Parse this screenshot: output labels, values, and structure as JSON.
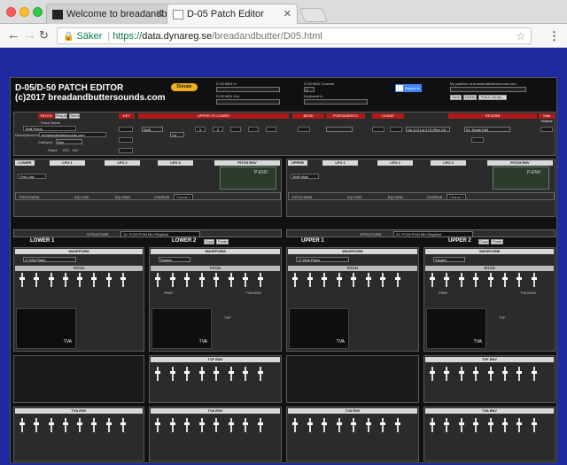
{
  "browser": {
    "tabs": [
      {
        "label": "Welcome to breadandbuttersound",
        "active": false
      },
      {
        "label": "D-05 Patch Editor",
        "active": true
      }
    ],
    "address": {
      "secure_label": "Säker",
      "protocol": "https://",
      "host": "data.dynareg.se",
      "path": "/breadandbutter/D05.html"
    }
  },
  "editor": {
    "title_line1": "D-05/D-50 PATCH EDITOR",
    "title_line2": "(c)2017 breadandbuttersounds.com",
    "donate": "Donate",
    "midi_in": "D-05 MIDI In",
    "midi_out": "D-05 MIDI Out",
    "midi_channel": "D-05 MIDI Channel",
    "midi_channel_value": "1",
    "keyboard_in": "Keyboard In",
    "google_signin": "Signed in",
    "patches_at": "My patches at breadandbuttersounds.com",
    "save_btn": "Save",
    "delete_btn": "Delete",
    "library_btn": "Patch Library...",
    "patch_label": "PATCH",
    "request_btn": "Request",
    "send_btn": "Send",
    "patch_name_label": "Patch Name",
    "patch_name": "BnB Piano",
    "desc_label": "Description/Info",
    "desc_value": "breadandbuttersounds.com",
    "category_label": "Category",
    "category_value": "Key",
    "share_label": "Share",
    "share_yes": "YES",
    "share_no": "NO",
    "sections": {
      "key": "KEY",
      "upper_vs_lower": "UPPER VS LOWER",
      "bend": "BEND",
      "portamento": "PORTAMENTO",
      "chase": "CHASE",
      "reverb": "REVERB",
      "total_volume": "Total Volume"
    },
    "key_values": {
      "key_mode": "Split",
      "split_point": "C4",
      "lower_tone": "0",
      "upper_tone": "0",
      "reverb_type": "01: Small Hall",
      "output_mode": "Up 1+2 Lw 1+2 (Rev 14)"
    },
    "lower_tone_name": "Pno Low",
    "upper_tone_name": "BnB High",
    "lower_label": "LOWER",
    "upper_label": "UPPER",
    "lfo1": "LFO 1",
    "lfo2": "LFO 2",
    "lfo3": "LFO 3",
    "pitch_env": "PITCH ENV",
    "penv": "P-ENV",
    "pitch_mod": "PITCH MOD",
    "eq_low": "EQ LOW",
    "eq_high": "EQ HIGH",
    "chorus": "CHORUS",
    "chorus_value": "Chorus 1",
    "structure": "STRUCTURE",
    "structure_value_lower": "10: PCM+PCM Mix RingMod",
    "structure_value_upper": "02: PCM+PCM Mix RingMod",
    "lower1": "LOWER 1",
    "lower2": "LOWER 2",
    "upper1": "UPPER 1",
    "upper2": "UPPER 2",
    "copy_btn": "Copy",
    "paste_btn": "Paste",
    "waveform": "WAVEFORM",
    "waveform_l1": "17 Mid Piano",
    "waveform_l2": "Square",
    "waveform_u1": "17 High Piano",
    "waveform_u2": "Square",
    "pitch": "PITCH",
    "tvf": "TVF",
    "tva": "TVA",
    "tvf_env": "TVF ENV",
    "tva_env": "TVA ENV",
    "pwm": "PWM",
    "tva_mod": "TVA MOD"
  }
}
